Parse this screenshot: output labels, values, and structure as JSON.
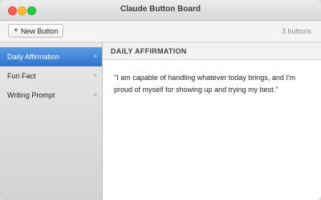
{
  "window": {
    "title": "Claude Button Board"
  },
  "toolbar": {
    "new_button_label": "New Button",
    "new_button_icon": "+",
    "count": "3 buttons"
  },
  "sidebar": {
    "items": [
      {
        "label": "Daily Affirmation",
        "close": "×",
        "selected": true
      },
      {
        "label": "Fun Fact",
        "close": "×",
        "selected": false
      },
      {
        "label": "Writing Prompt",
        "close": "×",
        "selected": false
      }
    ]
  },
  "main": {
    "header": "DAILY AFFIRMATION",
    "text": "\"I am capable of handling whatever today brings, and I'm proud of myself for showing up and trying my best.\""
  },
  "colors": {
    "selection": "#2f74cf",
    "close_dot": "#fd5f57",
    "minimize_dot": "#febc2e",
    "maximize_dot": "#28c840"
  }
}
